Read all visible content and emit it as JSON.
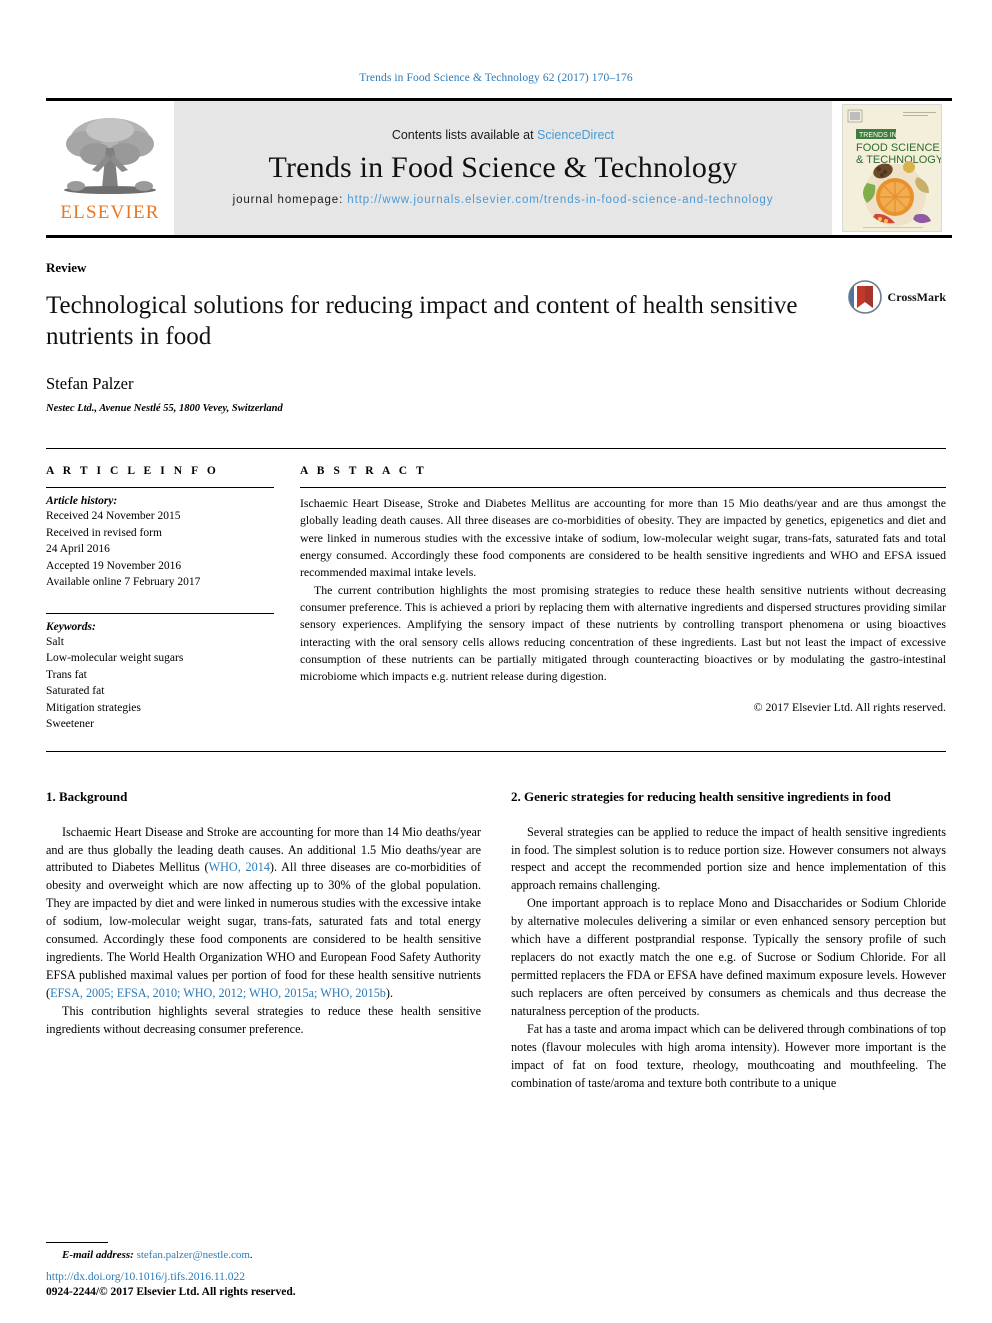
{
  "running_head": "Trends in Food Science & Technology 62 (2017) 170–176",
  "masthead": {
    "publisher_name": "ELSEVIER",
    "contents_prefix": "Contents lists available at ",
    "contents_link": "ScienceDirect",
    "journal_title": "Trends in Food Science & Technology",
    "homepage_label": "journal homepage: ",
    "homepage_url": "http://www.journals.elsevier.com/trends-in-food-science-and-technology",
    "cover": {
      "elsevier_mark": "ELSEVIER",
      "banner": "TRENDS IN",
      "line1": "FOOD SCIENCE",
      "line2": "& TECHNOLOGY"
    }
  },
  "article": {
    "doctype": "Review",
    "title": "Technological solutions for reducing impact and content of health sensitive nutrients in food",
    "author": "Stefan Palzer",
    "affiliation": "Nestec Ltd., Avenue Nestlé 55, 1800 Vevey, Switzerland",
    "crossmark_label": "CrossMark"
  },
  "article_info": {
    "heading": "A R T I C L E   I N F O",
    "history_heading": "Article history:",
    "history": [
      "Received 24 November 2015",
      "Received in revised form",
      "24 April 2016",
      "Accepted 19 November 2016",
      "Available online 7 February 2017"
    ],
    "keywords_heading": "Keywords:",
    "keywords": [
      "Salt",
      "Low-molecular weight sugars",
      "Trans fat",
      "Saturated fat",
      "Mitigation strategies",
      "Sweetener"
    ]
  },
  "abstract": {
    "heading": "A B S T R A C T",
    "paragraphs": [
      "Ischaemic Heart Disease, Stroke and Diabetes Mellitus are accounting for more than 15 Mio deaths/year and are thus amongst the globally leading death causes. All three diseases are co-morbidities of obesity. They are impacted by genetics, epigenetics and diet and were linked in numerous studies with the excessive intake of sodium, low-molecular weight sugar, trans-fats, saturated fats and total energy consumed. Accordingly these food components are considered to be health sensitive ingredients and WHO and EFSA issued recommended maximal intake levels.",
      "The current contribution highlights the most promising strategies to reduce these health sensitive nutrients without decreasing consumer preference. This is achieved a priori by replacing them with alternative ingredients and dispersed structures providing similar sensory experiences. Amplifying the sensory impact of these nutrients by controlling transport phenomena or using bioactives interacting with the oral sensory cells allows reducing concentration of these ingredients. Last but not least the impact of excessive consumption of these nutrients can be partially mitigated through counteracting bioactives or by modulating the gastro-intestinal microbiome which impacts e.g. nutrient release during digestion."
    ],
    "copyright": "© 2017 Elsevier Ltd. All rights reserved."
  },
  "body": {
    "left": {
      "section_title": "1. Background",
      "paragraph_1_a": "Ischaemic Heart Disease and Stroke are accounting for more than 14 Mio deaths/year and are thus globally the leading death causes. An additional 1.5 Mio deaths/year are attributed to Diabetes Mellitus (",
      "paragraph_1_cite_1": "WHO, 2014",
      "paragraph_1_b": "). All three diseases are co-morbidities of obesity and overweight which are now affecting up to 30% of the global population. They are impacted by diet and were linked in numerous studies with the excessive intake of sodium, low-molecular weight sugar, trans-fats, saturated fats and total energy consumed. Accordingly these food components are considered to be health sensitive ingredients. The World Health Organization WHO and European Food Safety Authority EFSA published maximal values per portion of food for these health sensitive nutrients (",
      "paragraph_1_cite_2": "EFSA, 2005; EFSA, 2010; WHO, 2012; WHO, 2015a; WHO, 2015b",
      "paragraph_1_c": ").",
      "paragraph_2": "This contribution highlights several strategies to reduce these health sensitive ingredients without decreasing consumer preference."
    },
    "right": {
      "section_title": "2. Generic strategies for reducing health sensitive ingredients in food",
      "paragraph_1": "Several strategies can be applied to reduce the impact of health sensitive ingredients in food. The simplest solution is to reduce portion size. However consumers not always respect and accept the recommended portion size and hence implementation of this approach remains challenging.",
      "paragraph_2": "One important approach is to replace Mono and Disaccharides or Sodium Chloride by alternative molecules delivering a similar or even enhanced sensory perception but which have a different postprandial response. Typically the sensory profile of such replacers do not exactly match the one e.g. of Sucrose or Sodium Chloride. For all permitted replacers the FDA or EFSA have defined maximum exposure levels. However such replacers are often perceived by consumers as chemicals and thus decrease the naturalness perception of the products.",
      "paragraph_3": "Fat has a taste and aroma impact which can be delivered through combinations of top notes (flavour molecules with high aroma intensity). However more important is the impact of fat on food texture, rheology, mouthcoating and mouthfeeling. The combination of taste/aroma and texture both contribute to a unique"
    }
  },
  "footer": {
    "email_label": "E-mail address:",
    "email": "stefan.palzer@nestle.com",
    "email_suffix": ".",
    "doi": "http://dx.doi.org/10.1016/j.tifs.2016.11.022",
    "issn_line": "0924-2244/© 2017 Elsevier Ltd. All rights reserved."
  },
  "colors": {
    "link_blue": "#2b7bb9",
    "light_blue": "#4a9ad4",
    "elsevier_orange": "#E87722",
    "masthead_grey": "#e6e6e6"
  }
}
